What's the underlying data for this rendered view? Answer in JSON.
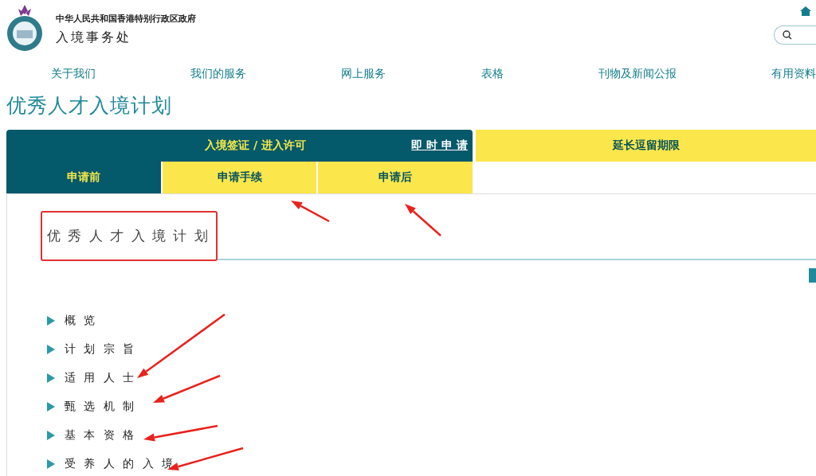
{
  "header": {
    "government": "中华人民共和国香港特别行政区政府",
    "department": "入境事务处"
  },
  "nav": [
    "关于我们",
    "我们的服务",
    "网上服务",
    "表格",
    "刊物及新闻公报",
    "有用资料"
  ],
  "page_title": "优秀人才入境计划",
  "tabs": [
    {
      "label": "入境签证 / 进入许可",
      "selected": true,
      "link": "即 时 申 请"
    },
    {
      "label": "延长逗留期限",
      "selected": false
    }
  ],
  "subtabs": [
    {
      "label": "申请前",
      "selected": true
    },
    {
      "label": "申请手续",
      "selected": false
    },
    {
      "label": "申请后",
      "selected": false
    }
  ],
  "section_title": "优 秀 人 才 入 境 计 划",
  "items": [
    "概 览",
    "计 划 宗 旨",
    "适 用 人 士",
    "甄 选 机 制",
    "基 本 资 格",
    "受 养 人 的 入 境"
  ]
}
